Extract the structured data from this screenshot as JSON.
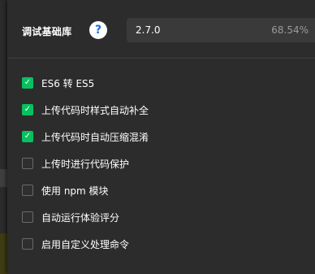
{
  "library": {
    "label": "调试基础库",
    "help_icon": "?",
    "version": "2.7.0",
    "percent": "68.54%",
    "chevron": "⌄"
  },
  "options": [
    {
      "label": "ES6 转 ES5",
      "checked": true
    },
    {
      "label": "上传代码时样式自动补全",
      "checked": true
    },
    {
      "label": "上传代码时自动压缩混淆",
      "checked": true
    },
    {
      "label": "上传时进行代码保护",
      "checked": false
    },
    {
      "label": "使用 npm 模块",
      "checked": false
    },
    {
      "label": "自动运行体验评分",
      "checked": false
    },
    {
      "label": "启用自定义处理命令",
      "checked": false
    }
  ],
  "colors": {
    "accent": "#07c160",
    "help_icon_fg": "#1d6fe0",
    "panel_bg": "#2c2c2c"
  }
}
